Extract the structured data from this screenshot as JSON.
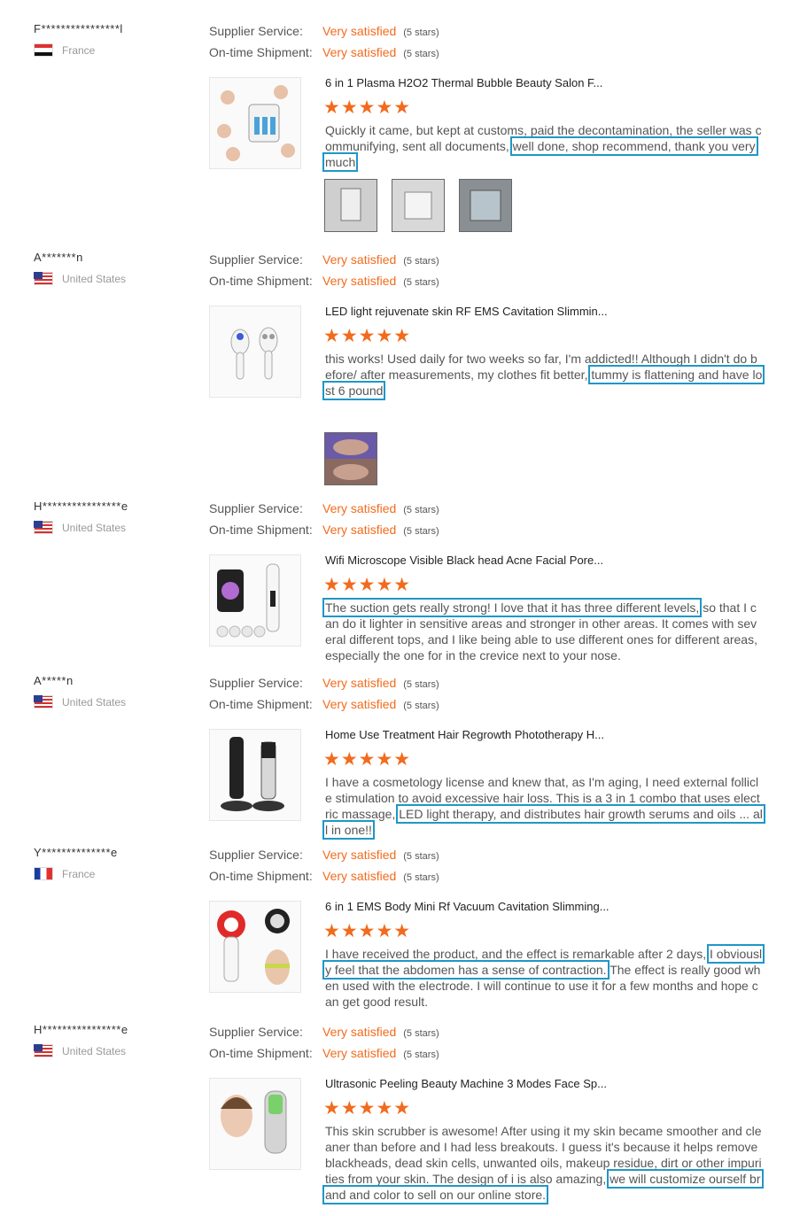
{
  "labels": {
    "supplier": "Supplier Service:",
    "shipment": "On-time Shipment:",
    "satisfied": "Very satisfied",
    "stars": "(5 stars)"
  },
  "rating_stars": "★★★★★",
  "accent_color": "#f26b1d",
  "highlight_color": "#1f97c7",
  "reviews": [
    {
      "user": "F****************l",
      "country": "France",
      "product": "6 in 1 Plasma H2O2 Thermal Bubble Beauty Salon F...",
      "text_a": "Quickly it came, but kept at customs, paid the decontamination, the seller was communifying, sent all documents,",
      "text_hl": "well done, shop recommend, thank you very much",
      "text_b": ""
    },
    {
      "user": "A*******n",
      "country": "United States",
      "product": "LED light rejuvenate skin RF EMS Cavitation Slimmin...",
      "text_a": "this works! Used daily for two weeks so far, I'm addicted!! Although I didn't do before/ after measurements, my clothes fit better,",
      "text_hl": "tummy is flattening and have lost 6 pound",
      "text_b": ""
    },
    {
      "user": "H****************e",
      "country": "United States",
      "product": "Wifi Microscope Visible Black head Acne Facial Pore...",
      "text_a": "",
      "text_hl": "The suction gets really strong! I love that it has three different levels,",
      "text_b": "so that I can do it lighter in sensitive areas and stronger in other areas. It comes with several different tops, and I like being able to use different ones for different areas, especially the one for in the crevice next to your nose."
    },
    {
      "user": "A*****n",
      "country": "United States",
      "product": "Home Use Treatment Hair Regrowth Phototherapy H...",
      "text_a": "I have a cosmetology license and knew that, as I'm aging, I need external follicle stimulation to avoid excessive hair loss. This is a 3 in 1 combo that uses electric massage,",
      "text_hl": "LED light therapy, and distributes hair growth serums and oils ... all in one!!",
      "text_b": ""
    },
    {
      "user": "Y**************e",
      "country": "France",
      "product": "6 in 1 EMS Body Mini Rf Vacuum Cavitation Slimming...",
      "text_a": "I have received the product, and the effect is remarkable after 2 days,",
      "text_hl": "I obviously feel that the abdomen has a sense of contraction.",
      "text_b": "The effect is really good when used with the electrode. I will continue to use it for a few months and hope can get good result."
    },
    {
      "user": "H****************e",
      "country": "United States",
      "product": "Ultrasonic Peeling Beauty Machine 3 Modes Face Sp...",
      "text_a": "This skin scrubber is awesome! After using it my skin became smoother and cleaner than before and I had less breakouts. I guess it's because it helps remove blackheads, dead skin cells, unwanted oils, makeup residue, dirt or other impurities from your skin. The design of i is also amazing,",
      "text_hl": "we will customize ourself  brand and color to sell on our online store.",
      "text_b": ""
    }
  ]
}
